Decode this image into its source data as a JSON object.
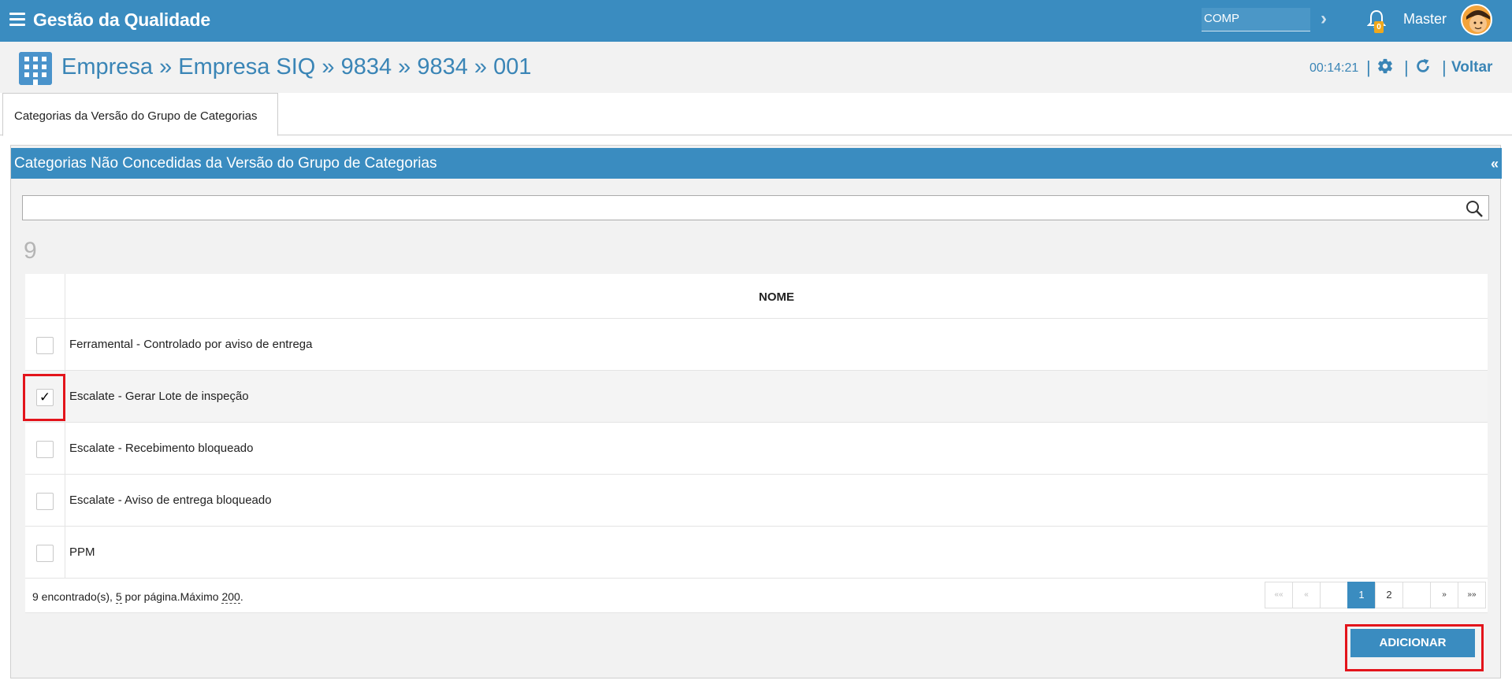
{
  "app": {
    "title": "Gestão da Qualidade"
  },
  "topbar": {
    "comp_value": "COMP",
    "notification_count": "0",
    "user_name": "Master"
  },
  "breadcrumb": {
    "text": "Empresa » Empresa SIQ » 9834 » 9834 » 001"
  },
  "header_actions": {
    "time": "00:14:21",
    "sep": "|",
    "voltar": "Voltar"
  },
  "tabs": [
    {
      "label": "Categorias da Versão do Grupo de Categorias"
    }
  ],
  "panel": {
    "title": "Categorias Não Concedidas da Versão do Grupo de Categorias",
    "collapse_symbol": "«",
    "search_placeholder": "",
    "count": "9"
  },
  "table": {
    "columns": [
      "NOME"
    ],
    "rows": [
      {
        "name": "Ferramental - Controlado por aviso de entrega",
        "checked": false
      },
      {
        "name": "Escalate - Gerar Lote de inspeção",
        "checked": true
      },
      {
        "name": "Escalate - Recebimento bloqueado",
        "checked": false
      },
      {
        "name": "Escalate - Aviso de entrega bloqueado",
        "checked": false
      },
      {
        "name": "PPM",
        "checked": false
      }
    ],
    "checkmark": "✓"
  },
  "footer": {
    "found": "9 encontrado(s),",
    "per_page_num": "5",
    "per_page_text": "por página.Máximo",
    "max": "200",
    "max_suffix": "."
  },
  "pager": {
    "first": "««",
    "prev": "«",
    "pages": [
      "1",
      "2"
    ],
    "active_page": "1",
    "next": "»",
    "last": "»»"
  },
  "buttons": {
    "add": "ADICIONAR"
  },
  "colors": {
    "primary": "#3a8cc0",
    "highlight": "#e3141b",
    "badge": "#f0a81c"
  },
  "icons": [
    "menu-icon",
    "comp-arrow-icon",
    "bell-icon",
    "avatar",
    "building-icon",
    "gear-icon",
    "refresh-icon",
    "search-icon",
    "collapse-icon"
  ]
}
